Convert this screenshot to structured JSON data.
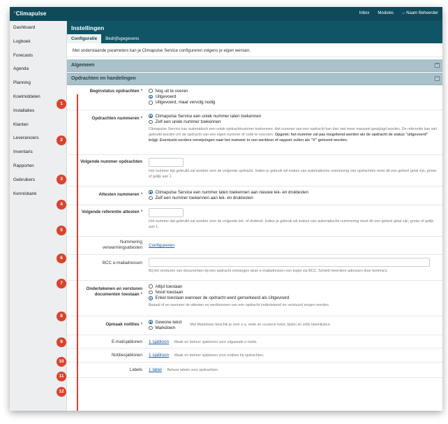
{
  "app": {
    "brand": "Climapulse"
  },
  "topnav": {
    "inbox": "Inbox",
    "modules": "Modules",
    "user": "Naam Beheerder",
    "chevron_glyph": "⌵"
  },
  "sidebar": {
    "items": [
      {
        "label": "Dashboard"
      },
      {
        "label": "Logboek"
      },
      {
        "label": "Forecasts"
      },
      {
        "label": "Agenda"
      },
      {
        "label": "Planning"
      },
      {
        "label": "Koelmiddelen"
      },
      {
        "label": "Installaties"
      },
      {
        "label": "Klanten"
      },
      {
        "label": "Leveranciers"
      },
      {
        "label": "Inventaris"
      },
      {
        "label": "Rapporten"
      },
      {
        "label": "Gebruikers"
      },
      {
        "label": "Kennisbank"
      }
    ]
  },
  "page": {
    "title": "Instellingen",
    "tabs": [
      {
        "label": "Configuratie",
        "active": true
      },
      {
        "label": "Bedrijfsgegevens",
        "active": false
      }
    ],
    "intro": "Met onderstaande parameters kan je Climapulse Service configureren volgens je eigen wensen."
  },
  "sections": {
    "general": {
      "title": "Algemeen",
      "toggle": "+"
    },
    "orders": {
      "title": "Opdrachten en handelingen",
      "toggle": "−"
    }
  },
  "settings": {
    "beginstatus": {
      "label": "Beginstatus opdrachten",
      "options": [
        "Nog uit te voeren",
        "Uitgevoerd",
        "Uitgevoerd, maar vervolg nodig"
      ],
      "selected": 1
    },
    "nummeren": {
      "label": "Opdrachten nummeren",
      "options": [
        "Climapulse Service een uniek nummer laten toekennen",
        "Zelf een uniek nummer toekennen"
      ],
      "selected": 0,
      "help": "Climapulse Service kan automatisch een uniek opdrachtnummer toekennen. Het nummer van een opdracht kan dan niet meer manueel gewijzigd worden. De referentie kan wel gebruikt worden om de opdracht van een eigen nummer of code te voorzien.",
      "help_bold": "Opgelet: het nummer zal pas toegekend worden als de opdracht de status \"uitgevoerd\" krijgt. Eventuele eerdere verwijzingen naar het nummer in een werkbon of rapport zullen als \"X\" getoond worden."
    },
    "volgende_nummer": {
      "label": "Volgende nummer opdrachten",
      "value": "",
      "help": "Het nummer dat gebruikt zal worden voor de volgende opdracht. Indien je gebruik wil maken van automatische nummering van opdrachten moet dit een geheel getal zijn, groter of gelijk aan 1."
    },
    "attesten": {
      "label": "Attesten nummeren",
      "options": [
        "Climapulse Service een nummer laten toekennen aan nieuwe lek- en druktesten",
        "Zelf een nummer toekennen aan lek- en druktesten"
      ],
      "selected": 0
    },
    "volgende_referentie": {
      "label": "Volgende referentie attesten",
      "value": "",
      "help": "Het nummer dat gebruikt zal worden voor de volgende lek- of druktest. Indien je gebruik wil maken van automatische nummering moet dit een geheel getal zijn, groter of gelijk aan 1."
    },
    "verwarming": {
      "label": "Nummering verwarmingsattesten",
      "link": "Configureren"
    },
    "bcc": {
      "label": "BCC e-mailadressen",
      "value": "",
      "help": "Bij het versturen van documenten bij een opdracht ontvangen deze e-mailadressen een kopie via BCC. Scheid meerdere adressen door komma's."
    },
    "ondertekenen": {
      "label": "Ondertekenen en versturen documenten toestaan",
      "options": [
        "Altijd toestaan",
        "Nooit toestaan",
        "Enkel toestaan wanneer de opdracht werd gemarkeerd als Uitgevoerd"
      ],
      "selected": 2,
      "help": "Bepaal of en wanneer de attesten en werkbonnen van een opdracht ondertekend en verstuurd mogen worden."
    },
    "opmaak": {
      "label": "Opmaak notities",
      "options": [
        "Gewone tekst",
        "Markdown"
      ],
      "selected": 0,
      "help": "Met Markdown beschik je over o.a. vette en cursieve tekst, lijsten en zelfs takenlijsten."
    },
    "emailsjablonen": {
      "label": "E-mailsjablonen",
      "link": "1 sjabloon",
      "help": "Maak en beheer sjablonen voor uitgaande e-mails."
    },
    "notitiesjablonen": {
      "label": "Notitiesjablonen",
      "link": "1 sjabloon",
      "help": "Maak en beheer sjablonen voor notities bij opdrachten."
    },
    "labels": {
      "label": "Labels",
      "link": "1 label",
      "help": "Beheer labels voor opdrachten."
    }
  },
  "markers": [
    "1",
    "2",
    "3",
    "4",
    "5",
    "6",
    "7",
    "8",
    "9",
    "10",
    "11",
    "12"
  ],
  "colors": {
    "topbar": "#0e4a5a",
    "header": "#0f5565",
    "section": "#a9c2ca",
    "marker": "#d9432e",
    "link": "#1b5b9e",
    "required": "#d0243a"
  }
}
